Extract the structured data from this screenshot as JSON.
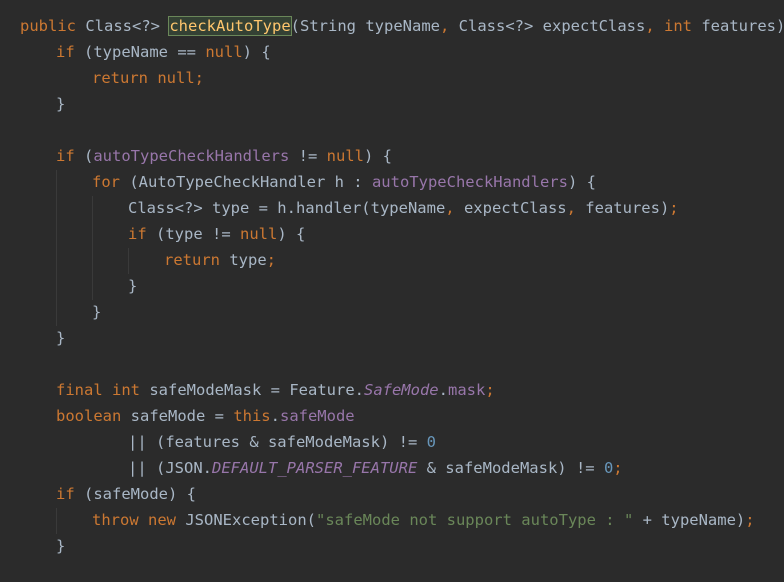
{
  "code_lines": [
    "public Class<?> checkAutoType(String typeName, Class<?> expectClass, int features) {",
    "    if (typeName == null) {",
    "        return null;",
    "    }",
    "",
    "    if (autoTypeCheckHandlers != null) {",
    "        for (AutoTypeCheckHandler h : autoTypeCheckHandlers) {",
    "            Class<?> type = h.handler(typeName, expectClass, features);",
    "            if (type != null) {",
    "                return type;",
    "            }",
    "        }",
    "    }",
    "",
    "    final int safeModeMask = Feature.SafeMode.mask;",
    "    boolean safeMode = this.safeMode",
    "            || (features & safeModeMask) != 0",
    "            || (JSON.DEFAULT_PARSER_FEATURE & safeModeMask) != 0;",
    "    if (safeMode) {",
    "        throw new JSONException(\"safeMode not support autoType : \" + typeName);",
    "    }"
  ],
  "tokens": {
    "kw_public": "public",
    "t_class_ret": "Class<?>",
    "fn_name": "checkAutoType",
    "p_open": "(",
    "t_string": "String typeName",
    "comma1": ",",
    "t_class_param": " Class<?> expectClass",
    "comma2": ",",
    "kw_int": "int",
    "p_features": " features) {",
    "kw_if1": "if",
    "l1_rest": " (typeName == ",
    "kw_null1": "null",
    "l1_end": ") {",
    "kw_return1": "return",
    "kw_null2": "null",
    "semi1": ";",
    "brace1": "}",
    "kw_if2": "if",
    "l5_a": " (",
    "fld_handlers1": "autoTypeCheckHandlers",
    "l5_b": " != ",
    "kw_null3": "null",
    "l5_c": ") {",
    "kw_for": "for",
    "l6_a": " (AutoTypeCheckHandler h : ",
    "fld_handlers2": "autoTypeCheckHandlers",
    "l6_b": ") {",
    "l7_a": "Class<?> type = h.handler(typeName",
    "comma3": ",",
    "l7_b": " expectClass",
    "comma4": ",",
    "l7_c": " features)",
    "semi2": ";",
    "kw_if3": "if",
    "l8_a": " (type != ",
    "kw_null4": "null",
    "l8_b": ") {",
    "kw_return2": "return",
    "l9_a": " type",
    "semi3": ";",
    "brace2": "}",
    "brace3": "}",
    "brace4": "}",
    "kw_final": "final",
    "kw_int2": "int",
    "l14_a": " safeModeMask = Feature.",
    "ifld_safemode": "SafeMode",
    "l14_b": ".",
    "fld_mask": "mask",
    "semi4": ";",
    "kw_boolean": "boolean",
    "l15_a": " safeMode = ",
    "kw_this": "this",
    "l15_b": ".",
    "fld_safemode": "safeMode",
    "l16_a": "|| (features & safeModeMask) != ",
    "num0a": "0",
    "l17_a": "|| (JSON.",
    "ifld_default": "DEFAULT_PARSER_FEATURE",
    "l17_b": " & safeModeMask) != ",
    "num0b": "0",
    "semi5": ";",
    "kw_if4": "if",
    "l18_a": " (safeMode) {",
    "kw_throw": "throw",
    "kw_new": "new",
    "l19_a": " JSONException(",
    "str_msg": "\"safeMode not support autoType : \"",
    "l19_b": " + typeName)",
    "semi6": ";",
    "brace5": "}"
  },
  "colors": {
    "background": "#2b2b2b",
    "default_text": "#a9b7c6",
    "keyword": "#cc7832",
    "function": "#ffc66d",
    "field": "#9876aa",
    "number": "#6897bb",
    "string": "#6a8759"
  }
}
